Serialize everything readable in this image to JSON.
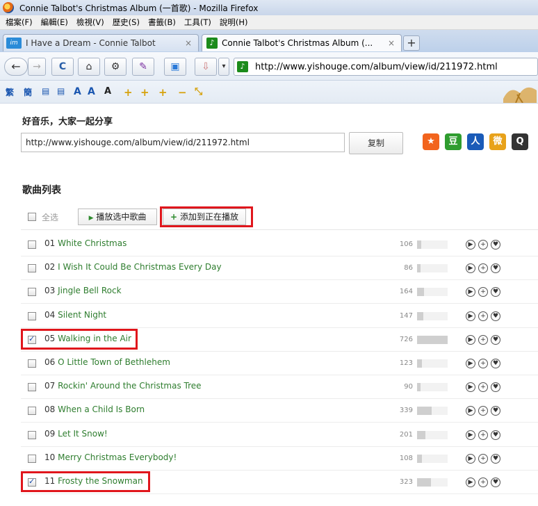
{
  "window": {
    "title": "Connie Talbot's Christmas Album (一首歌) - Mozilla Firefox"
  },
  "menu": [
    "檔案(F)",
    "編輯(E)",
    "檢視(V)",
    "歷史(S)",
    "書籤(B)",
    "工具(T)",
    "說明(H)"
  ],
  "tabs": [
    {
      "label": "I Have a Dream - Connie Talbot",
      "icon": "im-icon"
    },
    {
      "label": "Connie Talbot's Christmas Album (...",
      "icon": "music-note-icon"
    }
  ],
  "tab_close": "×",
  "new_tab": "+",
  "nav": {
    "url": "http://www.yishouge.com/album/view/id/211972.html",
    "back": "←",
    "forward": "→",
    "reload": "C",
    "home": "⌂"
  },
  "extensions": [
    "繁",
    "簡",
    "A",
    "A",
    "A",
    "+",
    "+",
    "+",
    "−"
  ],
  "share": {
    "title": "好音乐，大家一起分享",
    "url": "http://www.yishouge.com/album/view/id/211972.html",
    "copy_label": "复制",
    "icons": [
      {
        "name": "star-share-icon",
        "glyph": "★",
        "color": "#f2641d"
      },
      {
        "name": "douban-icon",
        "glyph": "豆",
        "color": "#2f9d2f"
      },
      {
        "name": "renren-icon",
        "glyph": "人",
        "color": "#1a5bb8"
      },
      {
        "name": "weibo-icon",
        "glyph": "微",
        "color": "#e8a21a"
      },
      {
        "name": "qq-icon",
        "glyph": "Q",
        "color": "#333333"
      }
    ]
  },
  "list": {
    "title": "歌曲列表",
    "select_all": "全选",
    "play_selected": "播放选中歌曲",
    "play_arrow": "▶",
    "add_to_playing": "添加到正在播放",
    "add_plus": "+",
    "max_plays": 726,
    "songs": [
      {
        "num": "01",
        "title": "White Christmas",
        "plays": 106,
        "checked": false,
        "highlight": false
      },
      {
        "num": "02",
        "title": "I Wish It Could Be Christmas Every Day",
        "plays": 86,
        "checked": false,
        "highlight": false
      },
      {
        "num": "03",
        "title": "Jingle Bell Rock",
        "plays": 164,
        "checked": false,
        "highlight": false
      },
      {
        "num": "04",
        "title": "Silent Night",
        "plays": 147,
        "checked": false,
        "highlight": false
      },
      {
        "num": "05",
        "title": "Walking in the Air",
        "plays": 726,
        "checked": true,
        "highlight": true
      },
      {
        "num": "06",
        "title": "O Little Town of Bethlehem",
        "plays": 123,
        "checked": false,
        "highlight": false
      },
      {
        "num": "07",
        "title": "Rockin' Around the Christmas Tree",
        "plays": 90,
        "checked": false,
        "highlight": false
      },
      {
        "num": "08",
        "title": "When a Child Is Born",
        "plays": 339,
        "checked": false,
        "highlight": false
      },
      {
        "num": "09",
        "title": "Let It Snow!",
        "plays": 201,
        "checked": false,
        "highlight": false
      },
      {
        "num": "10",
        "title": "Merry Christmas Everybody!",
        "plays": 108,
        "checked": false,
        "highlight": false
      },
      {
        "num": "11",
        "title": "Frosty the Snowman",
        "plays": 323,
        "checked": true,
        "highlight": true
      }
    ],
    "actions": [
      "▶",
      "+",
      "♥"
    ]
  },
  "colors": {
    "highlight": "#e0161c",
    "song_link": "#2e7d2e"
  }
}
